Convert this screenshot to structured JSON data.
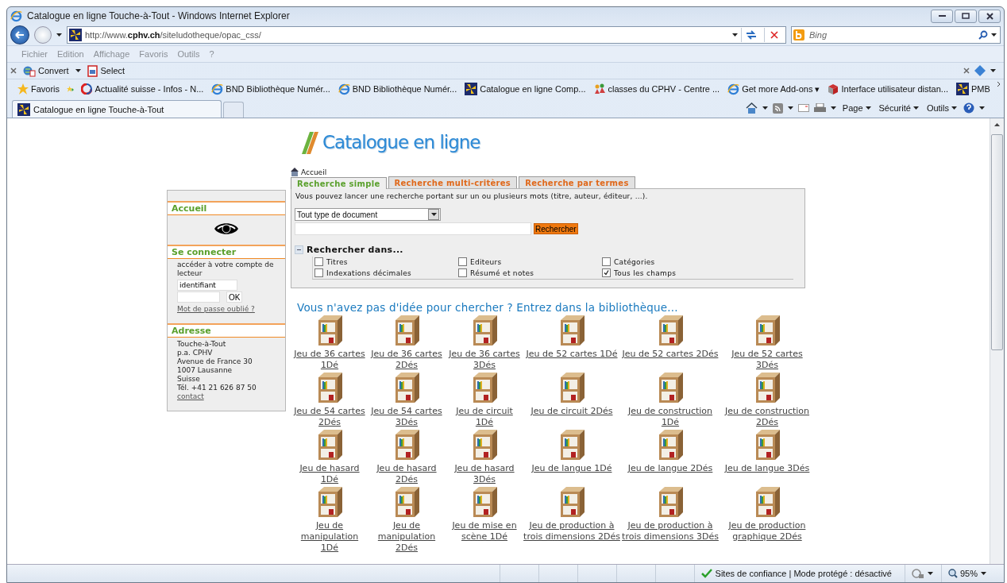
{
  "window": {
    "title": "Catalogue en ligne Touche-à-Tout - Windows Internet Explorer"
  },
  "address_bar": {
    "url": "http://www.**cphv.ch**/siteludotheque/opac_css/"
  },
  "search_box": {
    "placeholder": "Bing"
  },
  "menu_bar": [
    "Fichier",
    "Edition",
    "Affichage",
    "Favoris",
    "Outils",
    "?"
  ],
  "toolbar": {
    "buttons": [
      {
        "label": "Convert",
        "kind": "convert"
      },
      {
        "label": "Select",
        "kind": "select"
      }
    ]
  },
  "favorites_bar": {
    "label": "Favoris",
    "links": [
      {
        "label": "Actualité suisse - Infos - N...",
        "kind": "news"
      },
      {
        "label": "BND  Bibliothèque Numér...",
        "kind": "page"
      },
      {
        "label": "BND  Bibliothèque Numér...",
        "kind": "page"
      },
      {
        "label": "Catalogue en ligne Comp...",
        "kind": "site"
      },
      {
        "label": "classes du CPHV - Centre ...",
        "kind": "people"
      },
      {
        "label": "Get more Add-ons ▾",
        "kind": "page"
      },
      {
        "label": "Interface utilisateur distan...",
        "kind": "package"
      },
      {
        "label": "PMB",
        "kind": "site"
      }
    ]
  },
  "browser_tabs": [
    {
      "label": "Catalogue en ligne Touche-à-Tout",
      "selected": true
    }
  ],
  "command_bar": [
    "Page",
    "Sécurité",
    "Outils"
  ],
  "page": {
    "logo": {
      "text": "Catalogue en ligne"
    },
    "breadcrumb": "Accueil",
    "sidebar": {
      "home": {
        "title": "Accueil"
      },
      "login": {
        "title": "Se connecter",
        "prompt": "accéder à votre compte de lecteur",
        "username": "identifiant",
        "ok": "OK",
        "forgot": "Mot de passe oublié ?"
      },
      "address": {
        "title": "Adresse",
        "lines": [
          "Touche-à-Tout",
          "p.a. CPHV",
          "Avenue de France 30",
          "1007 Lausanne",
          "Suisse",
          "Tél. +41 21 626 87 50"
        ],
        "link": "contact"
      }
    },
    "tabs": [
      {
        "label": "Recherche simple",
        "selected": true
      },
      {
        "label": "Recherche multi-critères",
        "selected": false
      },
      {
        "label": "Recherche par termes",
        "selected": false
      }
    ],
    "intro": "Vous pouvez lancer une recherche portant sur un ou plusieurs mots (titre, auteur, éditeur, ...).",
    "doc_type": "Tout type de document",
    "search_button": "Rechercher",
    "search_in": {
      "title": "Rechercher dans...",
      "expanded": true,
      "options": [
        {
          "label": "Titres",
          "checked": false
        },
        {
          "label": "Editeurs",
          "checked": false
        },
        {
          "label": "Catégories",
          "checked": false
        },
        {
          "label": "Indexations décimales",
          "checked": false
        },
        {
          "label": "Résumé et notes",
          "checked": false
        },
        {
          "label": "Tous les champs",
          "checked": true
        }
      ]
    },
    "browse_heading": "Vous n'avez pas d'idée pour chercher ? Entrez dans la bibliothèque...",
    "shelves": [
      "Jeu de 36 cartes 1Dé",
      "Jeu de 36 cartes 2Dés",
      "Jeu de 36 cartes 3Dés",
      "Jeu de 52 cartes 1Dé",
      "Jeu de 52 cartes 2Dés",
      "Jeu de 52 cartes 3Dés",
      "Jeu de 54 cartes 2Dés",
      "Jeu de 54 cartes 3Dés",
      "Jeu de circuit 1Dé",
      "Jeu de circuit 2Dés",
      "Jeu de construction 1Dé",
      "Jeu de construction 2Dés",
      "Jeu de hasard 1Dé",
      "Jeu de hasard 2Dés",
      "Jeu de hasard 3Dés",
      "Jeu de langue 1Dé",
      "Jeu de langue 2Dés",
      "Jeu de langue 3Dés",
      "Jeu de manipulation 1Dé",
      "Jeu de manipulation 2Dés",
      "Jeu de mise en scène 1Dé",
      "Jeu de production à trois dimensions 2Dés",
      "Jeu de production à trois dimensions 3Dés",
      "Jeu de production graphique 2Dés"
    ]
  },
  "status_bar": {
    "zone": "Sites de confiance | Mode protégé : désactivé",
    "zoom": "95%"
  }
}
